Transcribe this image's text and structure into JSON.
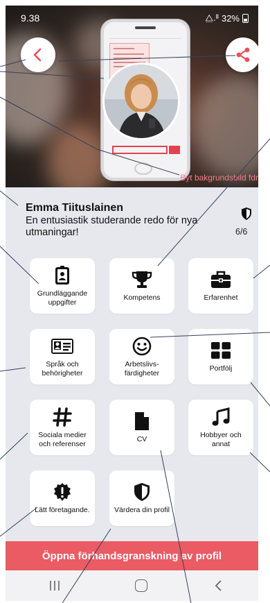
{
  "status_bar": {
    "time": "9.38",
    "signal": "⧋.ᴵᴵ",
    "battery": "32%"
  },
  "hero": {
    "background_change_label": "Byt bakgrundsbild fdr"
  },
  "profile": {
    "name": "Emma Tiituslainen",
    "tagline": "En entusiastik studerande redo för nya utmaningar!",
    "progress": "6/6"
  },
  "tiles": [
    {
      "label": "Grundläggande uppgifter",
      "icon": "id-badge-icon"
    },
    {
      "label": "Kompetens",
      "icon": "trophy-icon"
    },
    {
      "label": "Erfarenhet",
      "icon": "briefcase-icon"
    },
    {
      "label": "Språk och behörigheter",
      "icon": "id-card-icon"
    },
    {
      "label": "Arbetslivs-färdigheter",
      "icon": "smiley-icon"
    },
    {
      "label": "Portfölj",
      "icon": "grid-icon"
    },
    {
      "label": "Sociala medier och referenser",
      "icon": "hashtag-icon"
    },
    {
      "label": "CV",
      "icon": "document-icon"
    },
    {
      "label": "Hobbyer och annat",
      "icon": "music-note-icon"
    },
    {
      "label": "Lätt företagande.",
      "icon": "exclamation-badge-icon"
    },
    {
      "label": "Värdera din profil",
      "icon": "shield-icon"
    }
  ],
  "cta": {
    "label": "Öppna förhandsgranskning av profil"
  },
  "colors": {
    "accent": "#ea5b64",
    "background": "#e6e8ee",
    "tile": "#ffffff",
    "callout": "#33415c"
  }
}
